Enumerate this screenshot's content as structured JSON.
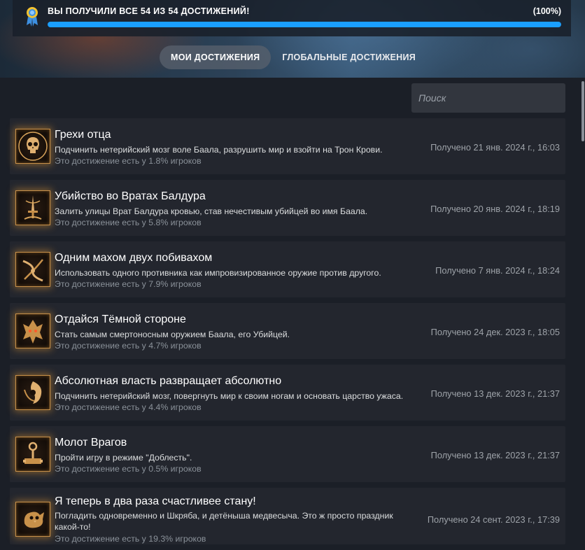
{
  "summary": {
    "text": "ВЫ ПОЛУЧИЛИ ВСЕ 54 ИЗ 54 ДОСТИЖЕНИЙ!",
    "percent_label": "(100%)",
    "progress": 1.0,
    "accent": "#1a9fff"
  },
  "tabs": [
    {
      "label": "МОИ ДОСТИЖЕНИЯ",
      "active": true
    },
    {
      "label": "ГЛОБАЛЬНЫЕ ДОСТИЖЕНИЯ",
      "active": false
    }
  ],
  "search": {
    "placeholder": "Поиск",
    "value": ""
  },
  "achievements": [
    {
      "title": "Грехи отца",
      "description": "Подчинить нетерийский мозг воле Баала, разрушить мир и взойти на Трон Крови.",
      "rarity": "Это достижение есть у 1.8% игроков",
      "date": "Получено 21 янв. 2024 г., 16:03",
      "icon": "skull-icon"
    },
    {
      "title": "Убийство во Вратах Балдура",
      "description": "Залить улицы Врат Балдура кровью, став нечестивым убийцей во имя Баала.",
      "rarity": "Это достижение есть у 5.8% игроков",
      "date": "Получено 20 янв. 2024 г., 18:19",
      "icon": "dagger-icon"
    },
    {
      "title": "Одним махом двух побивахом",
      "description": "Использовать одного противника как импровизированное оружие против другого.",
      "rarity": "Это достижение есть у 7.9% игроков",
      "date": "Получено 7 янв. 2024 г., 18:24",
      "icon": "throw-icon"
    },
    {
      "title": "Отдайся Тёмной стороне",
      "description": "Стать самым смертоносным оружием Баала, его Убийцей.",
      "rarity": "Это достижение есть у 4.7% игроков",
      "date": "Получено 24 дек. 2023 г., 18:05",
      "icon": "slayer-icon"
    },
    {
      "title": "Абсолютная власть развращает абсолютно",
      "description": "Подчинить нетерийский мозг, повергнуть мир к своим ногам и основать царство ужаса.",
      "rarity": "Это достижение есть у 4.4% игроков",
      "date": "Получено 13 дек. 2023 г., 21:37",
      "icon": "absolute-icon"
    },
    {
      "title": "Молот Врагов",
      "description": "Пройти игру в режиме \"Доблесть\".",
      "rarity": "Это достижение есть у 0.5% игроков",
      "date": "Получено 13 дек. 2023 г., 21:37",
      "icon": "hammer-icon"
    },
    {
      "title": "Я теперь в два раза счастливее стану!",
      "description": "Погладить одновременно и Шкряба, и детёныша медвесыча. Это ж просто праздник какой-то!",
      "rarity": "Это достижение есть у 19.3% игроков",
      "date": "Получено 24 сент. 2023 г., 17:39",
      "icon": "owlbear-icon"
    }
  ]
}
